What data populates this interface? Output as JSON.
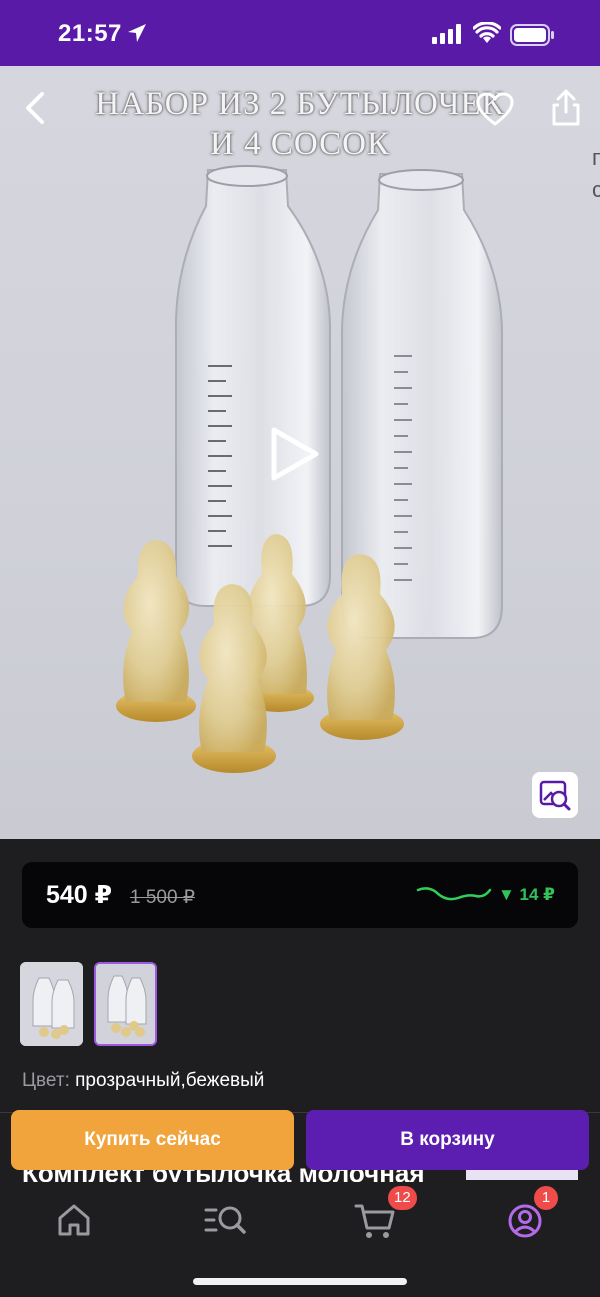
{
  "status_bar": {
    "time": "21:57",
    "bg_color": "#5a1aa8"
  },
  "hero": {
    "title_line1": "НАБОР ИЗ 2 БУТЫЛОЧЕК",
    "title_line2": "И 4 СОСОК",
    "edge_text_line1": "п",
    "edge_text_line2": "с",
    "icons": [
      "back-icon",
      "heart-icon",
      "share-icon",
      "play-icon",
      "visual-search-icon"
    ]
  },
  "price": {
    "current": "540 ₽",
    "old": "1 500 ₽",
    "drop": "▼ 14 ₽",
    "drop_color": "#32c25a"
  },
  "gallery": {
    "thumbnails": 2,
    "selected_index": 1
  },
  "product": {
    "color_label": "Цвет:",
    "color_value": "прозрачный,бежевый",
    "title_peek": "Комплект бутылочка молочная"
  },
  "actions": {
    "buy_now": "Купить сейчас",
    "buy_now_color": "#f1a43c",
    "add_to_cart": "В корзину",
    "add_to_cart_color": "#5b1eb0"
  },
  "tab_bar": {
    "items": [
      "home-icon",
      "catalog-search-icon",
      "cart-icon",
      "profile-icon"
    ],
    "cart_badge": "12",
    "profile_badge": "1"
  }
}
